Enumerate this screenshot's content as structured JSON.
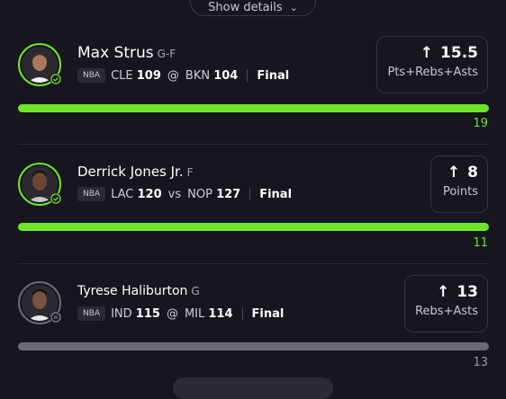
{
  "header": {
    "show_details_label": "Show details"
  },
  "legs": [
    {
      "player": "Max Strus",
      "position": "G-F",
      "league": "NBA",
      "team": "CLE",
      "team_score": "109",
      "separator": "@",
      "opponent": "BKN",
      "opponent_score": "104",
      "status": "Final",
      "line": "15.5",
      "stat": "Pts+Rebs+Asts",
      "actual": "19",
      "result": "win",
      "progress": 1.0
    },
    {
      "player": "Derrick Jones Jr.",
      "position": "F",
      "league": "NBA",
      "team": "LAC",
      "team_score": "120",
      "separator": "vs",
      "opponent": "NOP",
      "opponent_score": "127",
      "status": "Final",
      "line": "8",
      "stat": "Points",
      "actual": "11",
      "result": "win",
      "progress": 1.0
    },
    {
      "player": "Tyrese Haliburton",
      "position": "G",
      "league": "NBA",
      "team": "IND",
      "team_score": "115",
      "separator": "@",
      "opponent": "MIL",
      "opponent_score": "114",
      "status": "Final",
      "line": "13",
      "stat": "Rebs+Asts",
      "actual": "13",
      "result": "push",
      "progress": 1.0
    }
  ],
  "colors": {
    "win": "#6ee52b",
    "neutral": "#6a6a72",
    "background": "#17161f"
  },
  "icons": {
    "line_arrow": "arrow-up-icon",
    "win_badge": "check-circle-icon",
    "push_badge": "equals-circle-icon"
  }
}
